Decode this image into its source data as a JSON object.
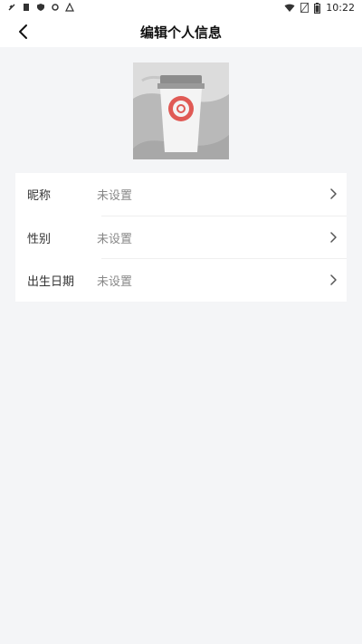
{
  "status_bar": {
    "time": "10:22",
    "icons": [
      "notification-icon",
      "clipboard-icon",
      "shield-icon",
      "settings-icon",
      "alert-icon",
      "wifi-icon",
      "no-sim-icon",
      "battery-icon"
    ]
  },
  "header": {
    "title": "编辑个人信息",
    "back_icon": "chevron-left-icon"
  },
  "avatar": {
    "description_icon": "coffee-cup-avatar"
  },
  "profile": {
    "rows": [
      {
        "label": "昵称",
        "value": "未设置"
      },
      {
        "label": "性别",
        "value": "未设置"
      },
      {
        "label": "出生日期",
        "value": "未设置"
      }
    ]
  },
  "colors": {
    "background": "#f4f5f7",
    "card": "#ffffff",
    "label": "#333333",
    "value": "#888888",
    "avatar_accent": "#e05a55"
  }
}
